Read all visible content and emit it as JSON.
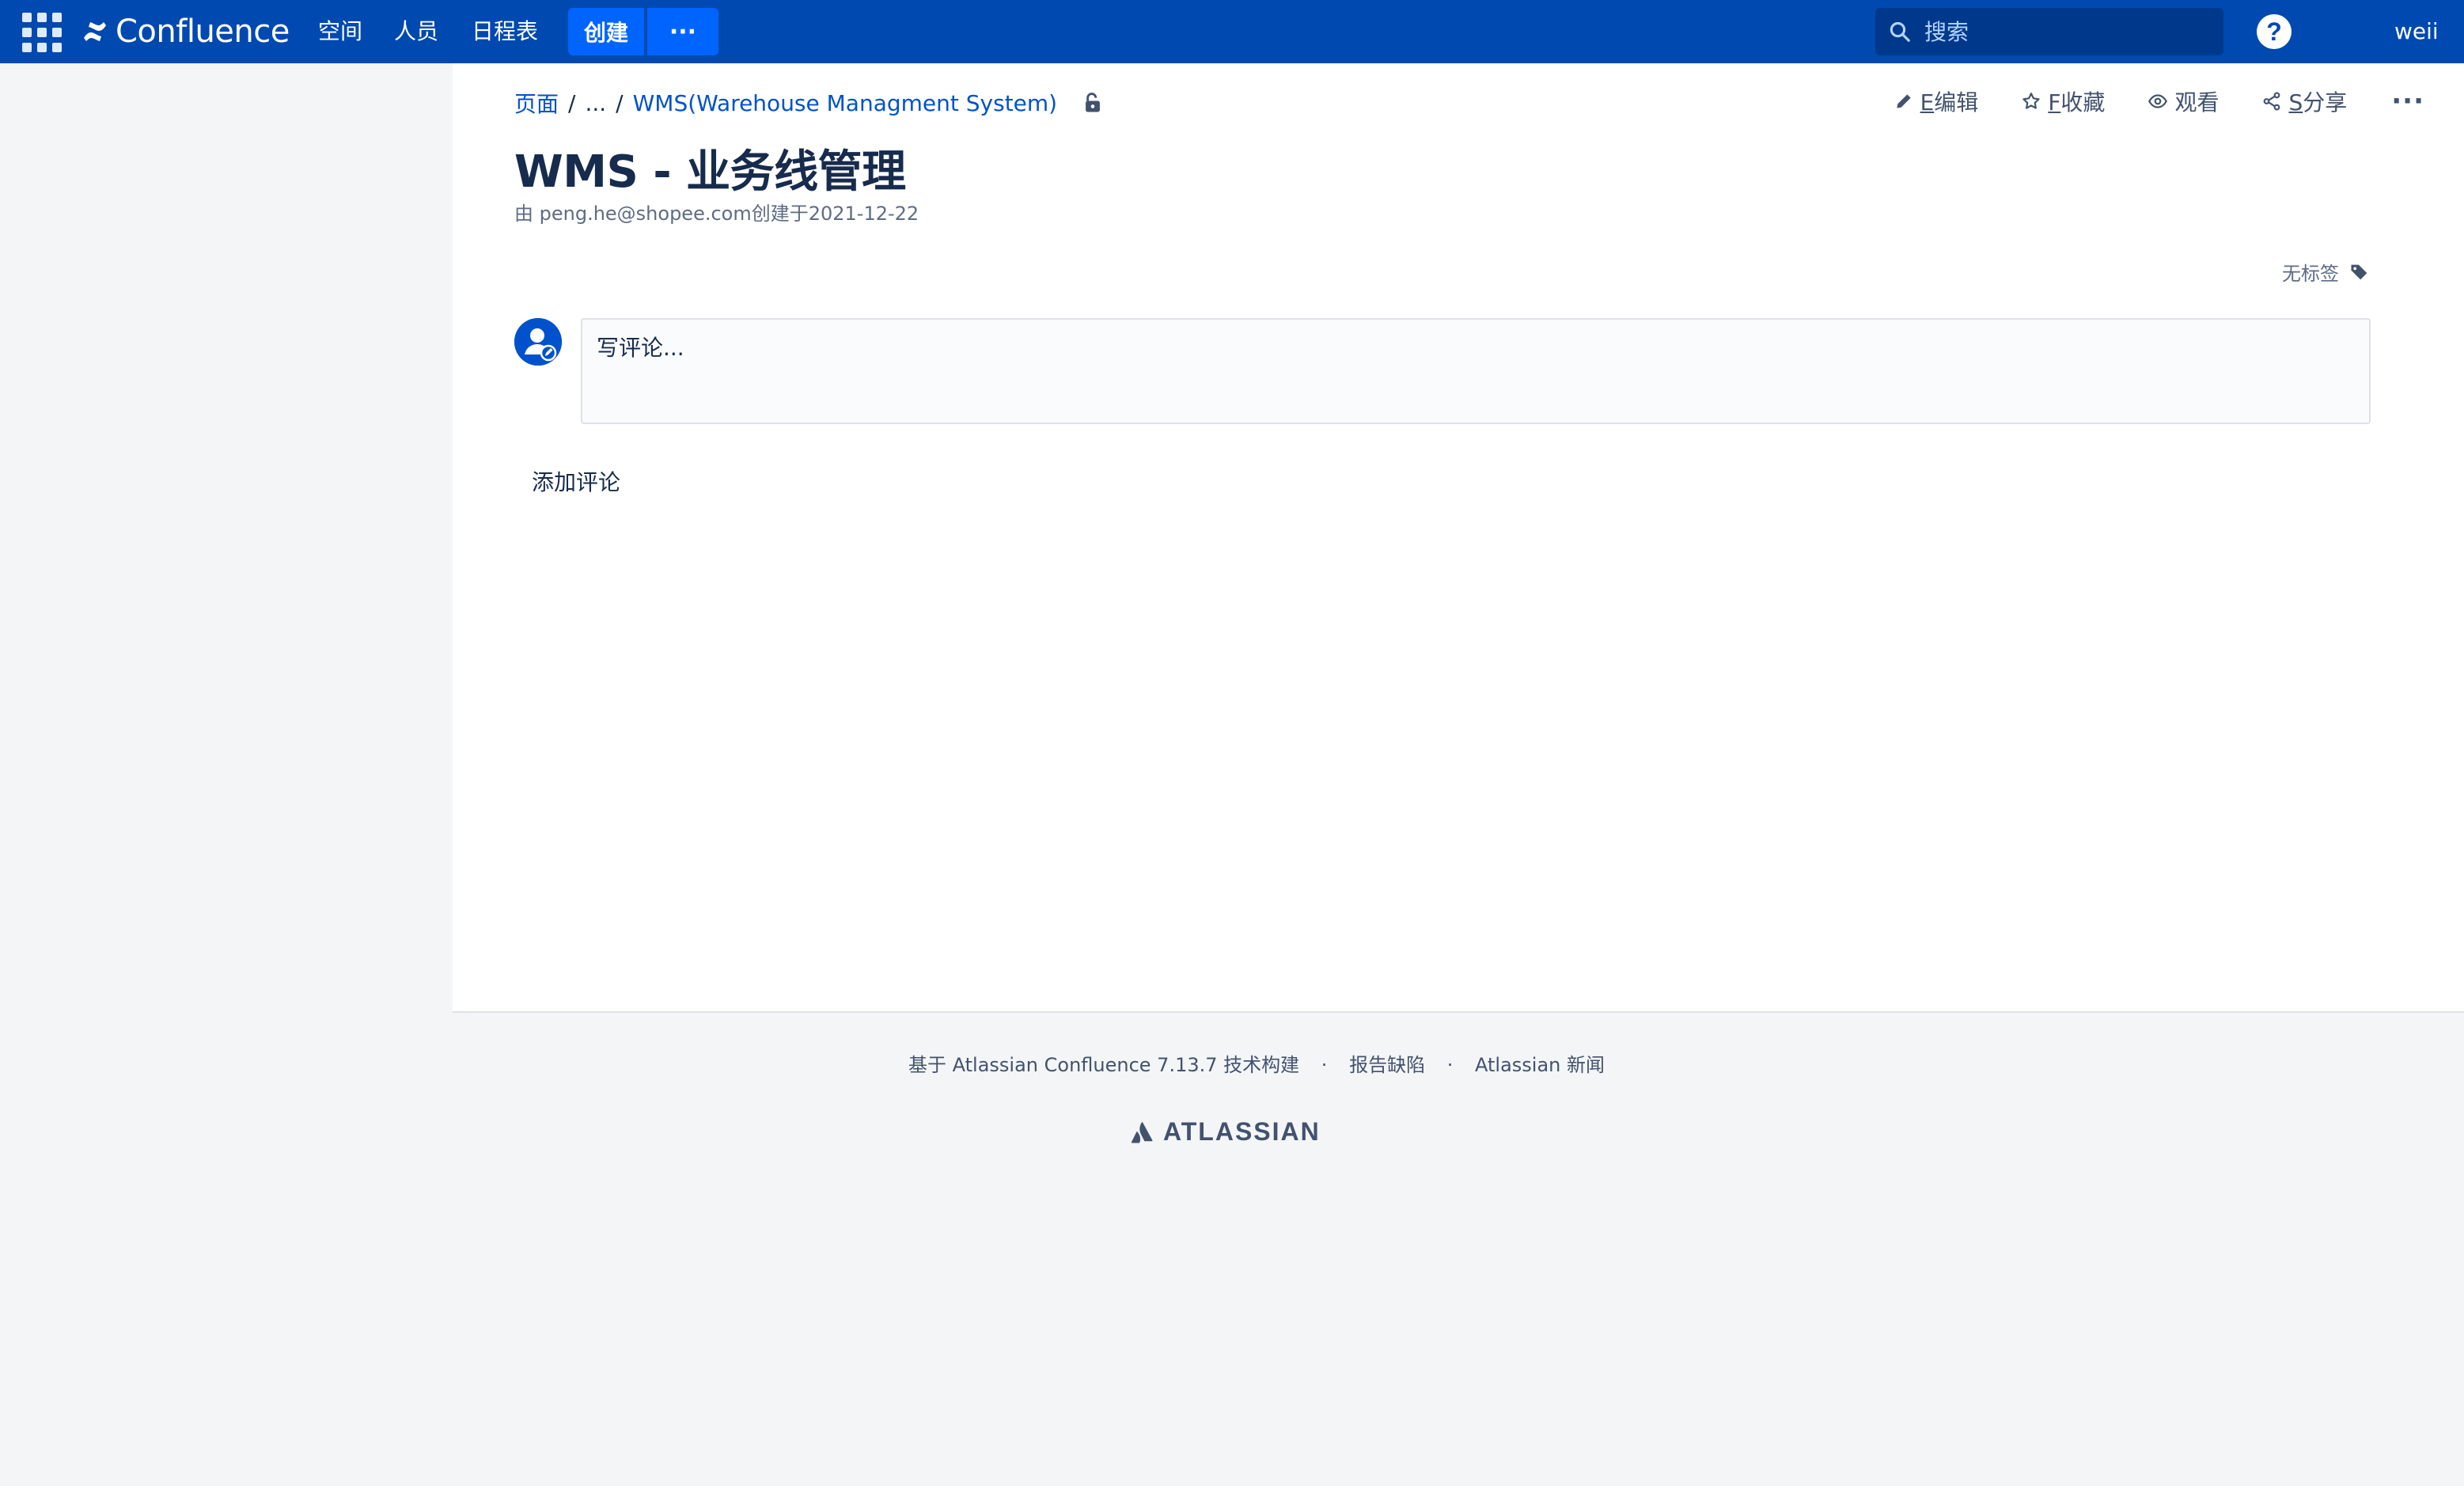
{
  "header": {
    "app_name": "Confluence",
    "nav": [
      "空间",
      "人员",
      "日程表"
    ],
    "create_label": "创建",
    "more_label": "···",
    "search_placeholder": "搜索",
    "help_label": "?",
    "user_name": "weii"
  },
  "breadcrumb": {
    "root": "页面",
    "sep1": "/",
    "ellipsis": "...",
    "sep2": "/",
    "parent": "WMS(Warehouse Managment System)"
  },
  "actions": {
    "edit_key": "E",
    "edit_label": "编辑",
    "favorite_key": "F",
    "favorite_label": "收藏",
    "watch_label": "观看",
    "share_key": "S",
    "share_label": "分享",
    "more_label": "···"
  },
  "page": {
    "title": "WMS - 业务线管理",
    "byline": "由 peng.he@shopee.com创建于2021-12-22",
    "no_labels": "无标签"
  },
  "comments": {
    "placeholder": "写评论...",
    "add_label": "添加评论"
  },
  "footer": {
    "built_on": "基于 Atlassian Confluence 7.13.7 技术构建",
    "dot1": "·",
    "report_bug": "报告缺陷",
    "dot2": "·",
    "news": "Atlassian 新闻",
    "brand": "ATLASSIAN"
  },
  "colors": {
    "header_bg": "#0049b0",
    "primary_button": "#0065ff",
    "link": "#0052cc",
    "text": "#172b4d",
    "muted": "#5e6c84",
    "page_bg": "#f4f5f7"
  }
}
